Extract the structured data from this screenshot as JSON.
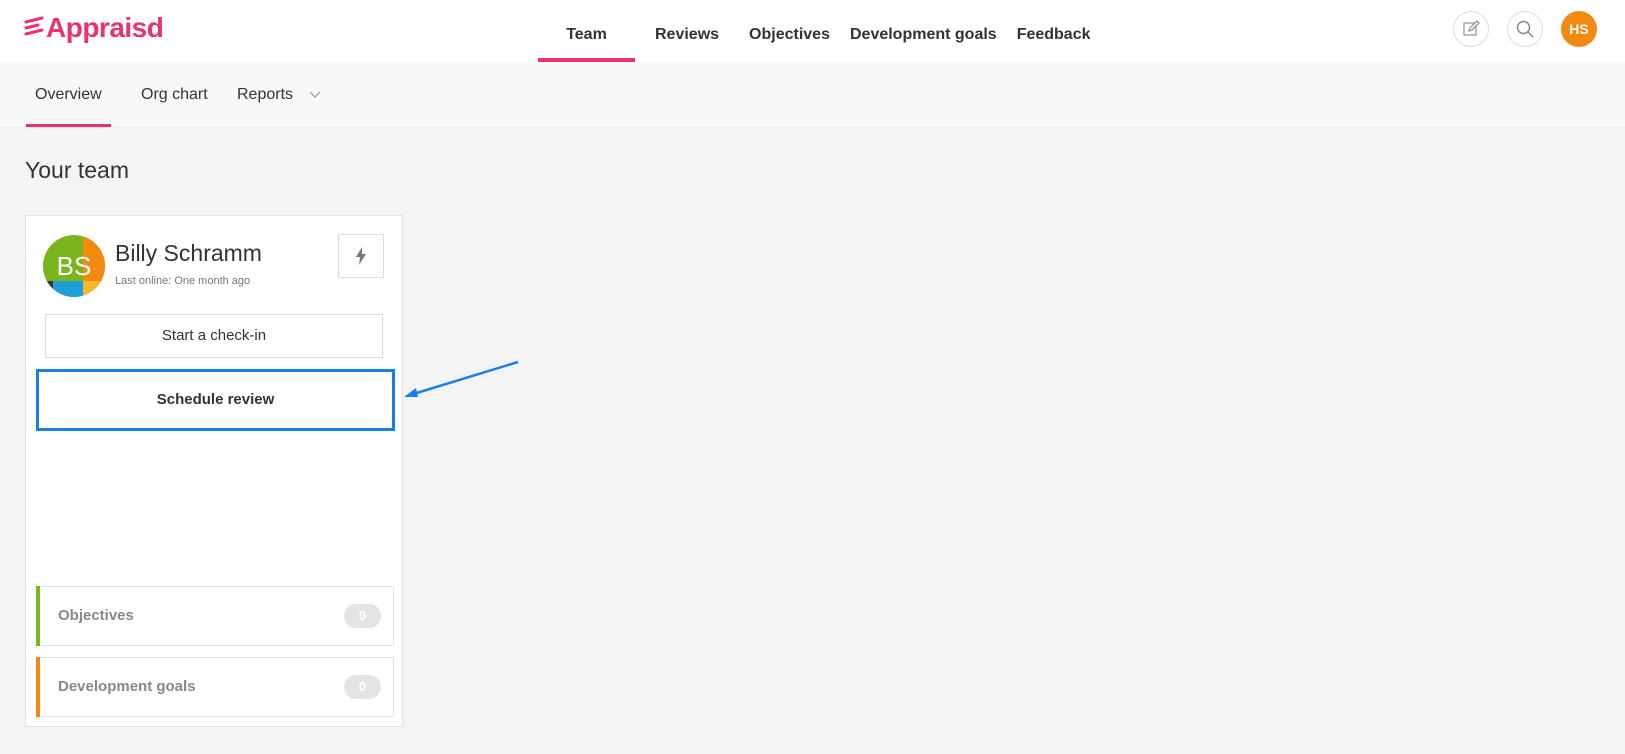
{
  "app": {
    "brand": "Appraisd"
  },
  "nav": [
    {
      "label": "Team",
      "active": true
    },
    {
      "label": "Reviews",
      "active": false
    },
    {
      "label": "Objectives",
      "active": false
    },
    {
      "label": "Development goals",
      "active": false
    },
    {
      "label": "Feedback",
      "active": false
    }
  ],
  "top_icons": {
    "edit": "edit-icon",
    "search": "search-icon",
    "user_initials": "HS"
  },
  "subnav": [
    {
      "label": "Overview",
      "active": true
    },
    {
      "label": "Org chart",
      "active": false
    },
    {
      "label": "Reports",
      "active": false
    }
  ],
  "main": {
    "title": "Your team",
    "card": {
      "initials": "BS",
      "name": "Billy Schramm",
      "last_online": "Last online: One month ago",
      "checkin_label": "Start a check-in",
      "schedule_label": "Schedule review",
      "stats": [
        {
          "label": "Objectives",
          "count": "0",
          "color": "#7ab51d"
        },
        {
          "label": "Development goals",
          "count": "0",
          "color": "#f28a12"
        }
      ]
    }
  },
  "colors": {
    "accent": "#e8336d",
    "highlight": "#1a7fe8",
    "avatar": "#f28a12"
  }
}
